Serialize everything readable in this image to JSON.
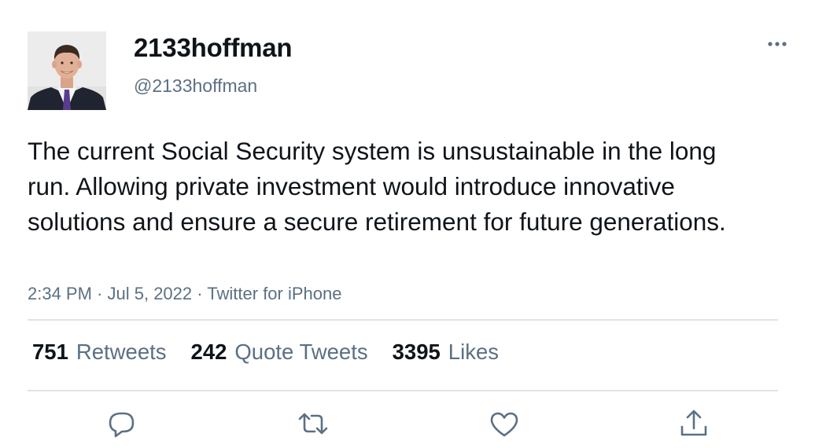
{
  "tweet": {
    "author": {
      "display_name": "2133hoffman",
      "handle": "@2133hoffman",
      "avatar": "profile-photo"
    },
    "text": "The current Social Security system is unsustainable in the long run. Allowing private investment would introduce innovative solutions and ensure a secure retirement for future generations.",
    "time": "2:34 PM",
    "date": "Jul 5, 2022",
    "source": "Twitter for iPhone",
    "separator": " · ",
    "stats": {
      "retweets": {
        "count": "751",
        "label": "Retweets"
      },
      "quote_tweets": {
        "count": "242",
        "label": "Quote Tweets"
      },
      "likes": {
        "count": "3395",
        "label": "Likes"
      }
    },
    "actions": [
      "reply-icon",
      "retweet-icon",
      "like-icon",
      "share-icon"
    ],
    "more_icon": "more-icon"
  },
  "colors": {
    "text_primary": "#0f1419",
    "text_secondary": "#5b7083",
    "divider": "#dfe3e6"
  }
}
